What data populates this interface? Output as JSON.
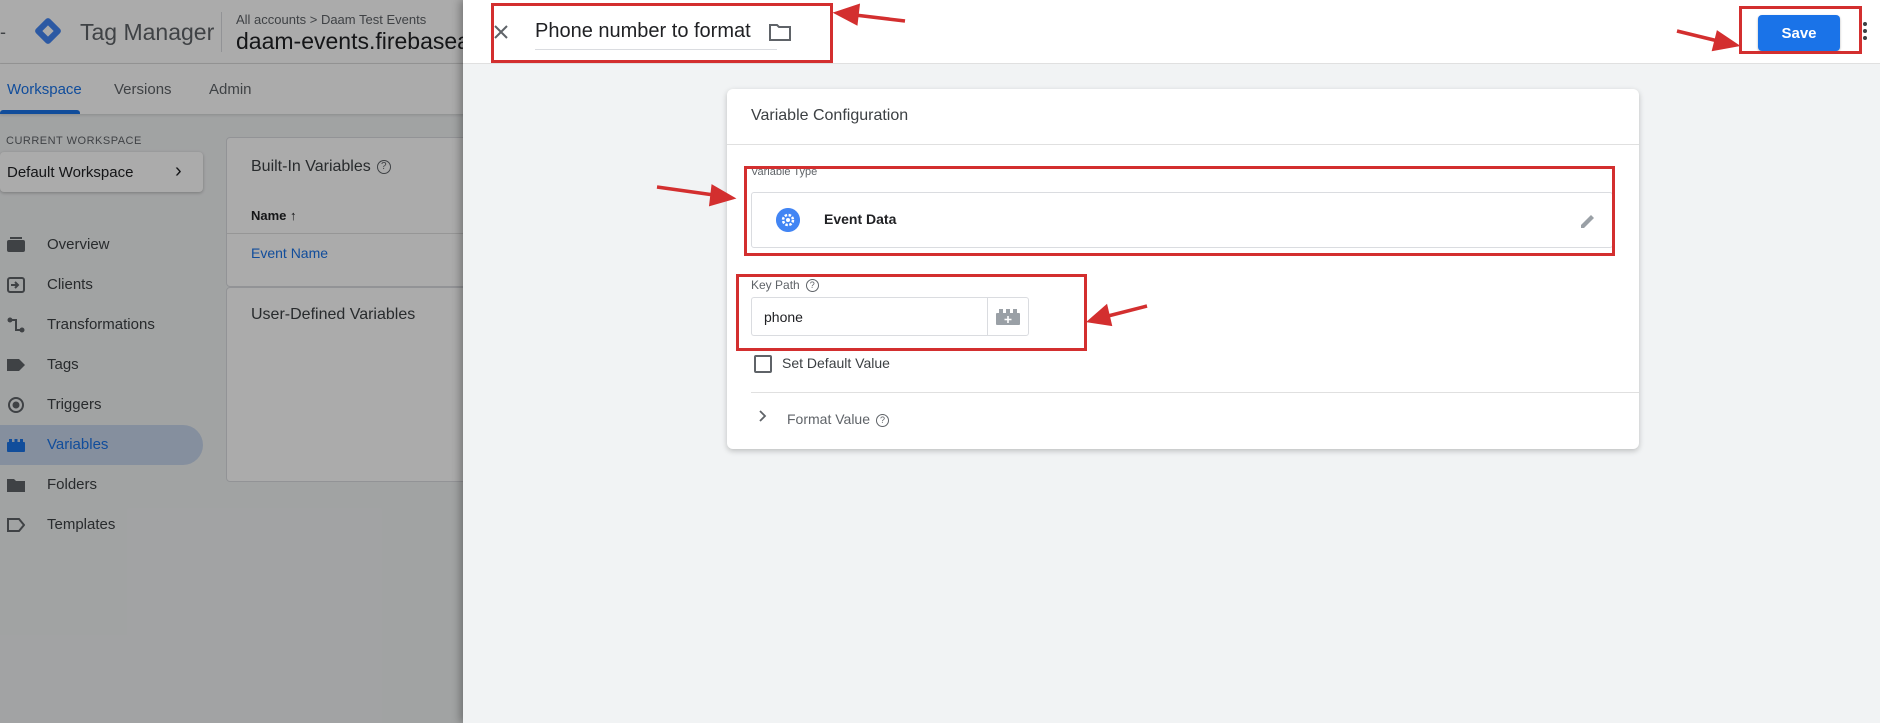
{
  "background": {
    "app_title": "Tag Manager",
    "breadcrumb": {
      "account": "All accounts",
      "separator": ">",
      "container_group": "Daam Test Events"
    },
    "container_name": "daam-events.firebasea",
    "tabs": [
      {
        "label": "Workspace"
      },
      {
        "label": "Versions"
      },
      {
        "label": "Admin"
      }
    ],
    "current_workspace_label": "CURRENT WORKSPACE",
    "workspace_name": "Default Workspace",
    "nav": [
      {
        "label": "Overview",
        "icon": "overview-icon"
      },
      {
        "label": "Clients",
        "icon": "clients-icon"
      },
      {
        "label": "Transformations",
        "icon": "transformations-icon"
      },
      {
        "label": "Tags",
        "icon": "tag-icon"
      },
      {
        "label": "Triggers",
        "icon": "trigger-icon"
      },
      {
        "label": "Variables",
        "icon": "variables-icon"
      },
      {
        "label": "Folders",
        "icon": "folder-icon"
      },
      {
        "label": "Templates",
        "icon": "template-icon"
      }
    ],
    "builtin_card": {
      "title": "Built-In Variables",
      "name_column": "Name",
      "sort_arrow": "↑",
      "row": "Event Name"
    },
    "user_defined_card": {
      "title": "User-Defined Variables"
    }
  },
  "panel": {
    "variable_name": "Phone number to format",
    "save_label": "Save",
    "config_title": "Variable Configuration",
    "variable_type_label": "Variable Type",
    "variable_type_value": "Event Data",
    "key_path_label": "Key Path",
    "key_path_value": "phone",
    "default_value_label": "Set Default Value",
    "default_value_checked": false,
    "format_value_label": "Format Value"
  },
  "colors": {
    "accent": "#1a73e8",
    "annotation": "#d32f2f",
    "nav_active_bg": "#c6d6ec"
  }
}
